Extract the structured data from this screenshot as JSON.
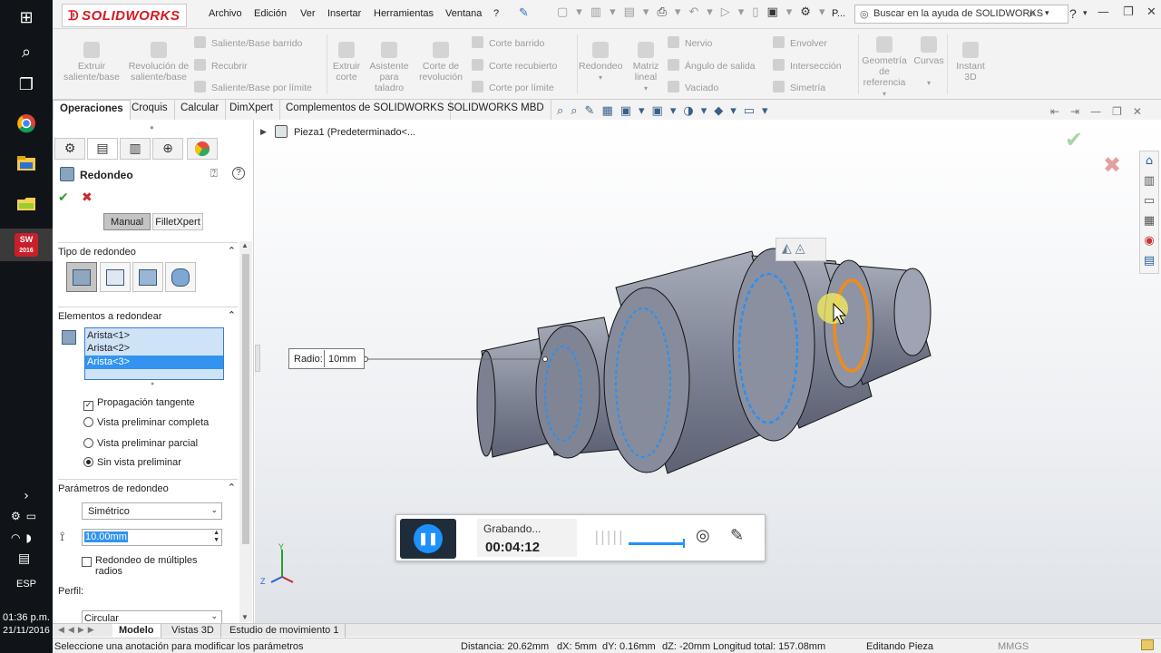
{
  "taskbar": {
    "time": "01:36 p.m.",
    "date": "21/11/2016",
    "lang": "ESP",
    "sw_badge": "2016"
  },
  "topbar": {
    "logo": "SOLIDWORKS",
    "menu": [
      "Archivo",
      "Edición",
      "Ver",
      "Insertar",
      "Herramientas",
      "Ventana",
      "?"
    ],
    "p_label": "P...",
    "help_placeholder": "Buscar en la ayuda de SOLIDWORKS",
    "help_q": "?"
  },
  "ribbon": {
    "extruir_saliente": "Extruir saliente/base",
    "revolucion_saliente": "Revolución de saliente/base",
    "saliente_barrido": "Saliente/Base barrido",
    "recubrir": "Recubrir",
    "saliente_limite": "Saliente/Base por límite",
    "extruir_corte": "Extruir corte",
    "asistente_taladro": "Asistente para taladro",
    "corte_revolucion": "Corte de revolución",
    "corte_barrido": "Corte barrido",
    "corte_recubierto": "Corte recubierto",
    "corte_limite": "Corte por límite",
    "redondeo": "Redondeo",
    "matriz_lineal": "Matriz lineal",
    "nervio": "Nervio",
    "angulo_salida": "Ángulo de salida",
    "vaciado": "Vaciado",
    "envolver": "Envolver",
    "interseccion": "Intersección",
    "simetria": "Simetría",
    "geometria_referencia": "Geometría de referencia",
    "curvas": "Curvas",
    "instant3d": "Instant 3D"
  },
  "tabs": [
    "Operaciones",
    "Croquis",
    "Calcular",
    "DimXpert",
    "Complementos de SOLIDWORKS",
    "SOLIDWORKS MBD"
  ],
  "tree": {
    "part": "Pieza1  (Predeterminado<..."
  },
  "panel": {
    "title": "Redondeo",
    "manual_btn": "Manual",
    "filletxpert_btn": "FilletXpert",
    "tipo_hdr": "Tipo de redondeo",
    "elementos_hdr": "Elementos a redondear",
    "edges": [
      "Arista<1>",
      "Arista<2>",
      "Arista<3>"
    ],
    "propagacion": "Propagación tangente",
    "vista_completa": "Vista preliminar completa",
    "vista_parcial": "Vista preliminar parcial",
    "sin_vista": "Sin vista preliminar",
    "parametros_hdr": "Parámetros de redondeo",
    "simetrico": "Simétrico",
    "radius_value": "10.00mm",
    "multiples": "Redondeo de múltiples radios",
    "perfil": "Perfil:",
    "circular": "Circular"
  },
  "callout": {
    "label": "Radio:",
    "value": "10mm"
  },
  "recorder": {
    "status": "Grabando...",
    "time": "00:04:12"
  },
  "triad": {
    "x": "X",
    "y": "Y",
    "z": "Z"
  },
  "bottom_tabs": [
    "Modelo",
    "Vistas 3D",
    "Estudio de movimiento 1"
  ],
  "status": {
    "hint": "Seleccione una anotación para modificar los parámetros",
    "distancia": "Distancia: 20.62mm",
    "dx": "dX: 5mm",
    "dy": "dY: 0.16mm",
    "dz": "dZ: -20mm",
    "longitud": "Longitud total: 157.08mm",
    "mode": "Editando Pieza",
    "units": "MMGS"
  },
  "colors": {
    "accent_blue": "#1e90ff",
    "selection_orange": "#f08a1c",
    "accept_green": "#2a9d2a",
    "cancel_red": "#c8282d"
  }
}
